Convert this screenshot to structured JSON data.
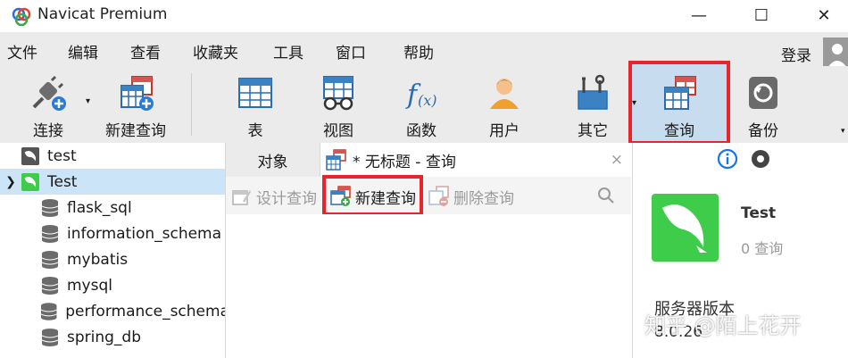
{
  "window": {
    "title": "Navicat Premium",
    "controls": {
      "minimize": "—",
      "maximize": "☐",
      "close": "✕"
    }
  },
  "menu": {
    "items": [
      "文件",
      "编辑",
      "查看",
      "收藏夹",
      "工具",
      "窗口",
      "帮助"
    ],
    "login": "登录"
  },
  "toolbar": {
    "connect": "连接",
    "new_query": "新建查询",
    "table": "表",
    "view": "视图",
    "function": "函数",
    "user": "用户",
    "other": "其它",
    "query": "查询",
    "backup": "备份"
  },
  "tree": {
    "connections": [
      {
        "name": "test",
        "expanded": false
      },
      {
        "name": "Test",
        "expanded": true,
        "selected": true
      }
    ],
    "databases": [
      "flask_sql",
      "information_schema",
      "mybatis",
      "mysql",
      "performance_schema",
      "spring_db"
    ]
  },
  "tabs": {
    "objects": "对象",
    "query_tab": "* 无标题 - 查询",
    "close": "×"
  },
  "subtoolbar": {
    "design": "设计查询",
    "new": "新建查询",
    "delete": "删除查询"
  },
  "info_panel": {
    "connection_name": "Test",
    "query_count": "0 查询",
    "server_version_label": "服务器版本",
    "server_version": "8.0.26"
  },
  "watermark": "知乎 @陌上花开",
  "colors": {
    "highlight_red": "#e8242c",
    "selection_blue": "#cce4f7",
    "mysql_green": "#3fcc4a",
    "info_blue": "#1a73e8"
  }
}
